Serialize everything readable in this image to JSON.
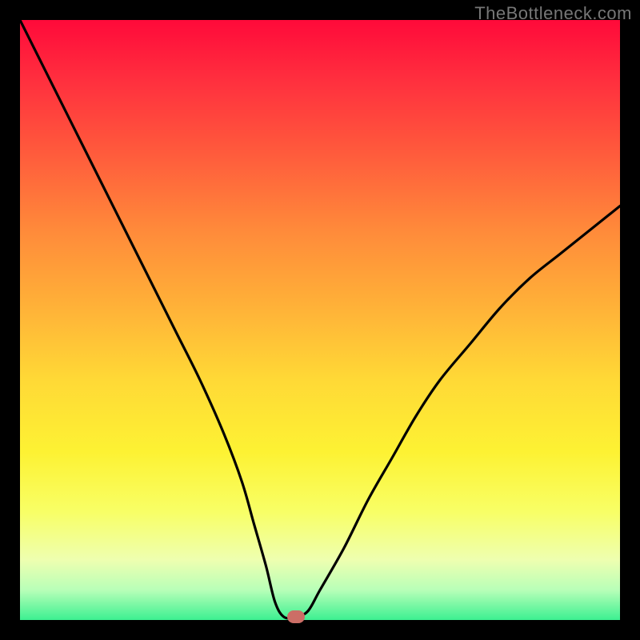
{
  "watermark": "TheBottleneck.com",
  "colors": {
    "frame": "#000000",
    "curve": "#000000",
    "marker": "#cc6e66"
  },
  "chart_data": {
    "type": "line",
    "title": "",
    "xlabel": "",
    "ylabel": "",
    "xlim": [
      0,
      100
    ],
    "ylim": [
      0,
      100
    ],
    "grid": false,
    "legend": false,
    "series": [
      {
        "name": "bottleneck-curve",
        "x": [
          0,
          3,
          6,
          10,
          14,
          18,
          22,
          26,
          30,
          34,
          37,
          39,
          41,
          42.5,
          44,
          46,
          48,
          50,
          54,
          58,
          62,
          66,
          70,
          75,
          80,
          85,
          90,
          95,
          100
        ],
        "y": [
          100,
          94,
          88,
          80,
          72,
          64,
          56,
          48,
          40,
          31,
          23,
          16,
          9,
          3,
          0.5,
          0.5,
          1.5,
          5,
          12,
          20,
          27,
          34,
          40,
          46,
          52,
          57,
          61,
          65,
          69
        ]
      }
    ],
    "annotations": [
      {
        "name": "optimum-marker",
        "x": 46,
        "y": 0.5
      }
    ],
    "background_gradient": {
      "direction": "vertical",
      "stops": [
        {
          "pos": 0,
          "color": "#ff0a3a"
        },
        {
          "pos": 35,
          "color": "#ff8a3a"
        },
        {
          "pos": 70,
          "color": "#fdf233"
        },
        {
          "pos": 95,
          "color": "#b8ffb8"
        },
        {
          "pos": 100,
          "color": "#3cf091"
        }
      ]
    }
  }
}
